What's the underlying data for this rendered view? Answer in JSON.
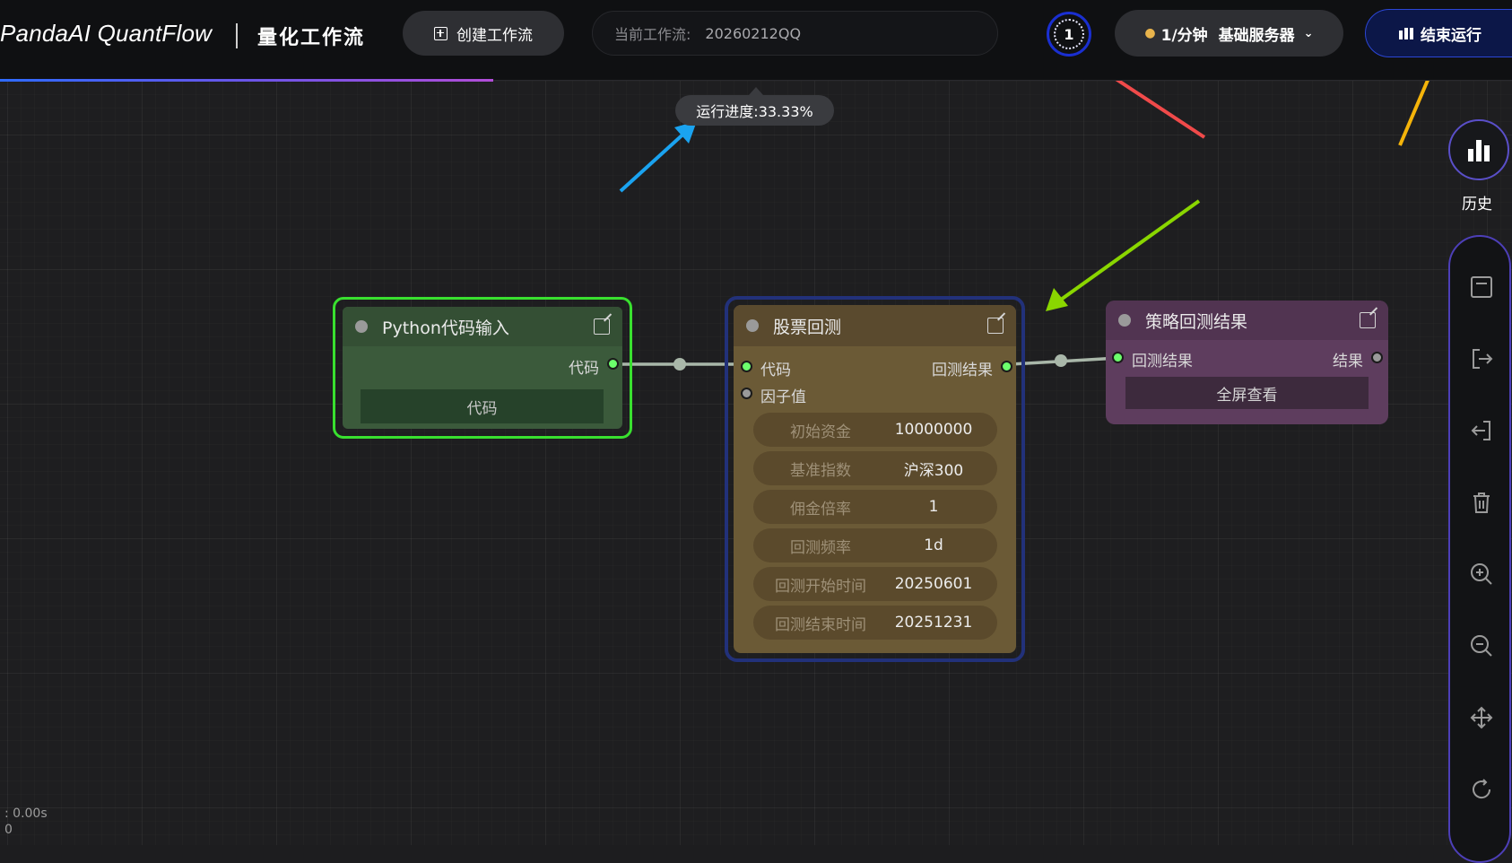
{
  "header": {
    "brand": "PandaAI QuantFlow",
    "subtitle": "量化工作流",
    "create_button": "创建工作流",
    "current_flow_label": "当前工作流:",
    "current_flow_value": "20260212QQ",
    "status_count": "1",
    "server_select": {
      "rate": "1/分钟",
      "server": "基础服务器"
    },
    "stop_button": "结束运行",
    "run_progress": 0.3333
  },
  "tooltip": {
    "progress_text": "运行进度:33.33%"
  },
  "nodes": {
    "python": {
      "title": "Python代码输入",
      "out_port": "代码",
      "code_button": "代码"
    },
    "backtest": {
      "title": "股票回测",
      "in_port_code": "代码",
      "in_port_factor": "因子值",
      "out_port": "回测结果",
      "params": [
        {
          "key": "初始资金",
          "value": "10000000"
        },
        {
          "key": "基准指数",
          "value": "沪深300"
        },
        {
          "key": "佣金倍率",
          "value": "1"
        },
        {
          "key": "回测频率",
          "value": "1d"
        },
        {
          "key": "回测开始时间",
          "value": "20250601"
        },
        {
          "key": "回测结束时间",
          "value": "20251231"
        }
      ]
    },
    "result": {
      "title": "策略回测结果",
      "in_port": "回测结果",
      "out_port": "结果",
      "fullscreen_button": "全屏查看"
    }
  },
  "sidebar": {
    "history_label": "历史",
    "tools": [
      "save-icon",
      "export-icon",
      "import-icon",
      "delete-icon",
      "zoom-in-icon",
      "zoom-out-icon",
      "fit-view-icon",
      "refresh-icon"
    ]
  },
  "stats": {
    "time": ": 0.00s",
    "count": "0"
  },
  "annotation_arrows": [
    "blue",
    "red",
    "green",
    "yellow"
  ],
  "colors": {
    "accent_blue": "#2b46d6",
    "python_border": "#39e02f",
    "backtest_border": "#22317a",
    "port_active": "#6cff6c"
  }
}
